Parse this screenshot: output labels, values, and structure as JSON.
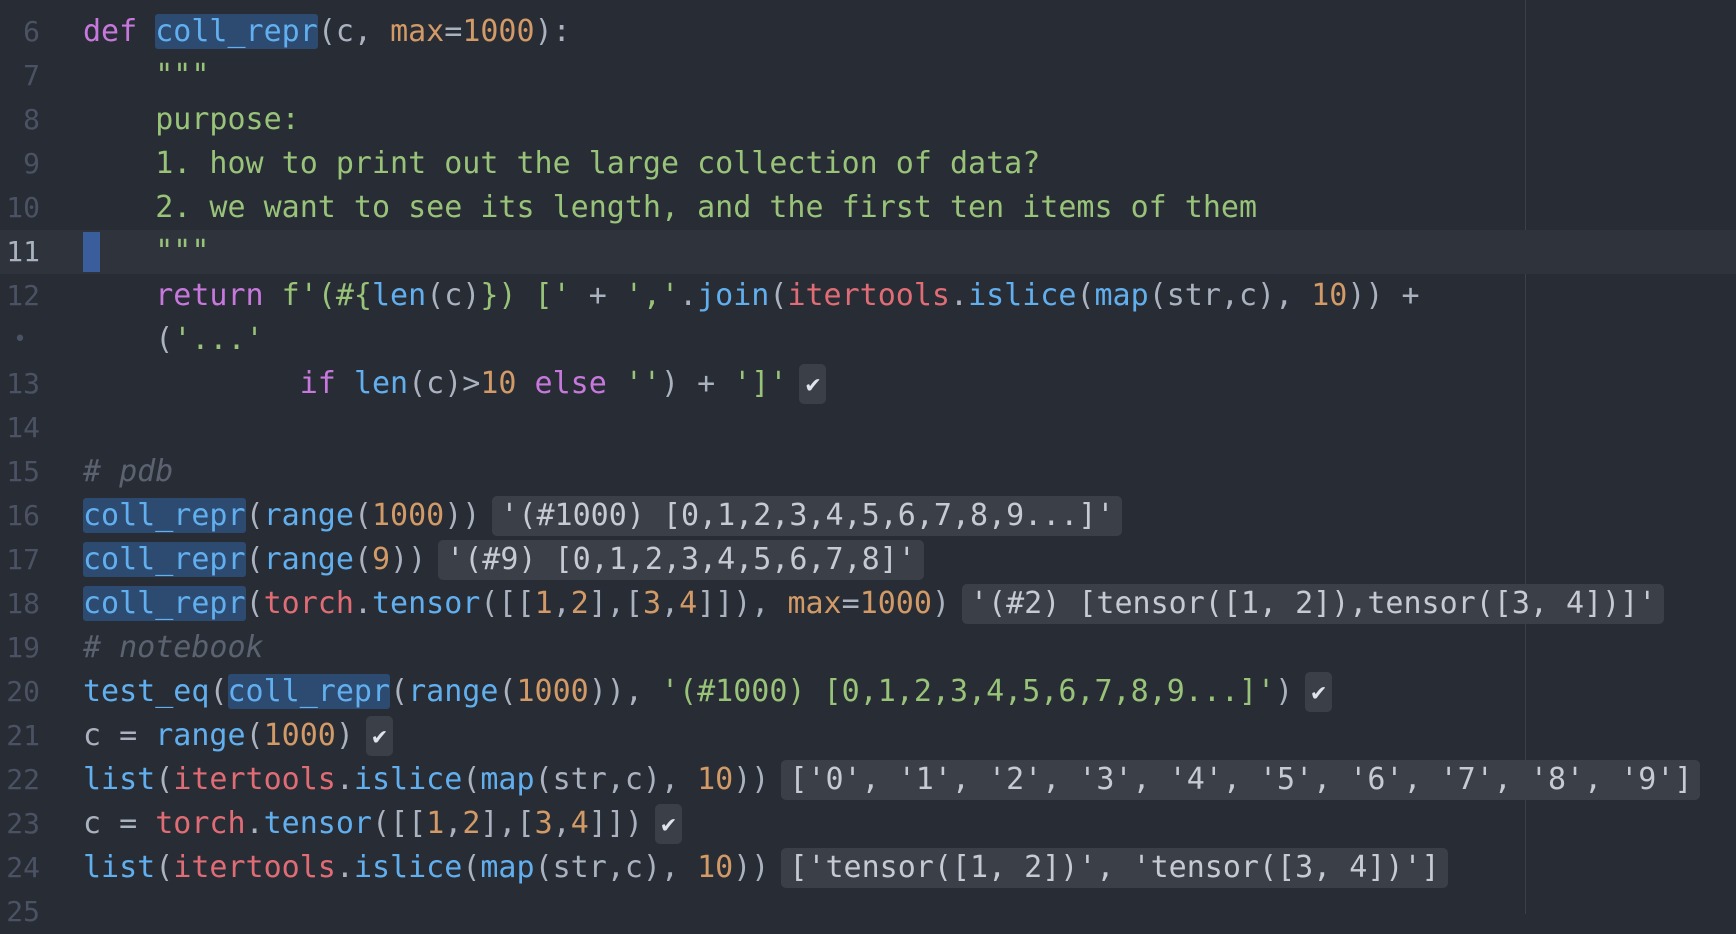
{
  "gutter": {
    "l6": "6",
    "l7": "7",
    "l8": "8",
    "l9": "9",
    "l10": "10",
    "l11": "11",
    "l12": "12",
    "fold": "•",
    "l13": "13",
    "l14": "14",
    "l15": "15",
    "l16": "16",
    "l17": "17",
    "l18": "18",
    "l19": "19",
    "l20": "20",
    "l21": "21",
    "l22": "22",
    "l23": "23",
    "l24": "24",
    "l25": "25"
  },
  "code": {
    "def_kw": "def",
    "fn_name": "coll_repr",
    "sig_open": "(c, ",
    "sig_param": "max",
    "sig_eq": "=",
    "sig_default": "1000",
    "sig_close": "):",
    "doc_open": "    \"\"\"",
    "doc_purpose": "    purpose:",
    "doc_item1": "    1. how to print out the large collection of data?",
    "doc_item2": "    2. we want to see its length, and the first ten items of them",
    "doc_close": "    \"\"\"",
    "ret_indent": "    ",
    "ret_kw": "return",
    "ret_fstr_a": " f'(#{",
    "ret_len": "len",
    "ret_c": "(c)",
    "ret_fstr_b": "}) ['",
    "ret_plus": " + ",
    "ret_comma": "','",
    "ret_dot": ".",
    "ret_join": "join",
    "ret_paren": "(",
    "ret_itertools": "itertools",
    "ret_dot2": ".",
    "ret_islice": "islice",
    "ret_paren2": "(",
    "ret_map": "map",
    "ret_args": "(str,c), ",
    "ret_ten": "10",
    "ret_end": ")) +",
    "cont_indent": "    (",
    "cont_str": "'...'",
    "if_indent": "            ",
    "if_kw": "if",
    "if_sp": " ",
    "if_len": "len",
    "if_cond": "(c)>",
    "if_ten": "10",
    "if_else": " else ",
    "if_empty": "''",
    "if_mid": ") + ",
    "if_bracket": "']'",
    "comment_pdb": "# pdb",
    "range_fn": "range",
    "call16_open": "(",
    "call16_arg": "1000",
    "call16_close": "))",
    "call17_open": "(",
    "call17_arg": "9",
    "call17_close": "))",
    "call18_open": "(",
    "torch": "torch",
    "dot": ".",
    "tensor": "tensor",
    "call18_a": "([[",
    "n1": "1",
    "comma": ",",
    "n2": "2",
    "call18_b": "],[",
    "n3": "3",
    "n4": "4",
    "call18_c": "]]), ",
    "max_kw": "max",
    "eq": "=",
    "n1000": "1000",
    "call18_close": ")",
    "comment_nb": "# notebook",
    "test_eq": "test_eq",
    "paren": "(",
    "call20_mid": "(1000)), ",
    "call20_str": "'(#1000) [0,1,2,3,4,5,6,7,8,9...]'",
    "call20_close": ")",
    "assign_c": "c = ",
    "call21_arg": "(1000)",
    "list_fn": "list",
    "itertools": "itertools",
    "islice": "islice",
    "map": "map",
    "map_args": "(str,c), ",
    "ten": "10",
    "close2": "))",
    "call23_a": "([[",
    "call23_b": "],[",
    "call23_c": "]])"
  },
  "results": {
    "r16": "'(#1000) [0,1,2,3,4,5,6,7,8,9...]'",
    "r17": "'(#9) [0,1,2,3,4,5,6,7,8]'",
    "r18": "'(#2) [tensor([1, 2]),tensor([3, 4])]'",
    "r22": "['0', '1', '2', '3', '4', '5', '6', '7', '8', '9']",
    "r24": "['tensor([1, 2])', 'tensor([3, 4])']",
    "check": "✔"
  }
}
